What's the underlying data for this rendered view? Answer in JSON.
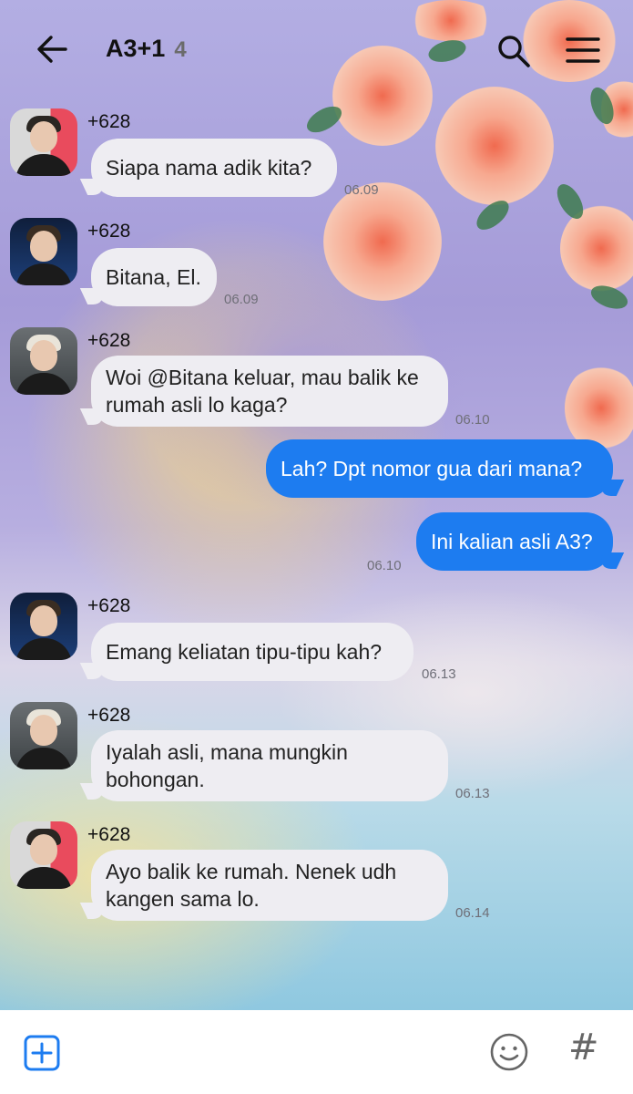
{
  "header": {
    "title": "A3+1",
    "member_count": "4"
  },
  "messages": [
    {
      "direction": "in",
      "sender": "+628",
      "avatar": "avatar-a",
      "text": "Siapa nama adik kita?",
      "time": "06.09"
    },
    {
      "direction": "in",
      "sender": "+628",
      "avatar": "avatar-b",
      "text": "Bitana, El.",
      "time": "06.09"
    },
    {
      "direction": "in",
      "sender": "+628",
      "avatar": "avatar-c",
      "text_lines": [
        "Woi @Bitana keluar, mau balik ke",
        "rumah asli lo kaga?"
      ],
      "time": "06.10"
    },
    {
      "direction": "out",
      "text": "Lah? Dpt nomor gua dari mana?"
    },
    {
      "direction": "out",
      "text": "Ini kalian asli A3?",
      "time": "06.10"
    },
    {
      "direction": "in",
      "sender": "+628",
      "avatar": "avatar-b",
      "text": "Emang keliatan tipu-tipu kah?",
      "time": "06.13"
    },
    {
      "direction": "in",
      "sender": "+628",
      "avatar": "avatar-c",
      "text_lines": [
        "Iyalah asli, mana mungkin",
        "bohongan."
      ],
      "time": "06.13"
    },
    {
      "direction": "in",
      "sender": "+628",
      "avatar": "avatar-a",
      "text_lines": [
        "Ayo balik ke rumah. Nenek udh",
        "kangen sama lo."
      ],
      "time": "06.14"
    }
  ],
  "footer": {
    "hash_label": "#"
  },
  "icons": [
    "back-arrow-icon",
    "search-icon",
    "menu-icon",
    "add-icon",
    "emoji-icon",
    "hash-icon"
  ],
  "colors": {
    "outgoing_bubble": "#1d7cf0",
    "incoming_bubble": "#eeedf2"
  }
}
